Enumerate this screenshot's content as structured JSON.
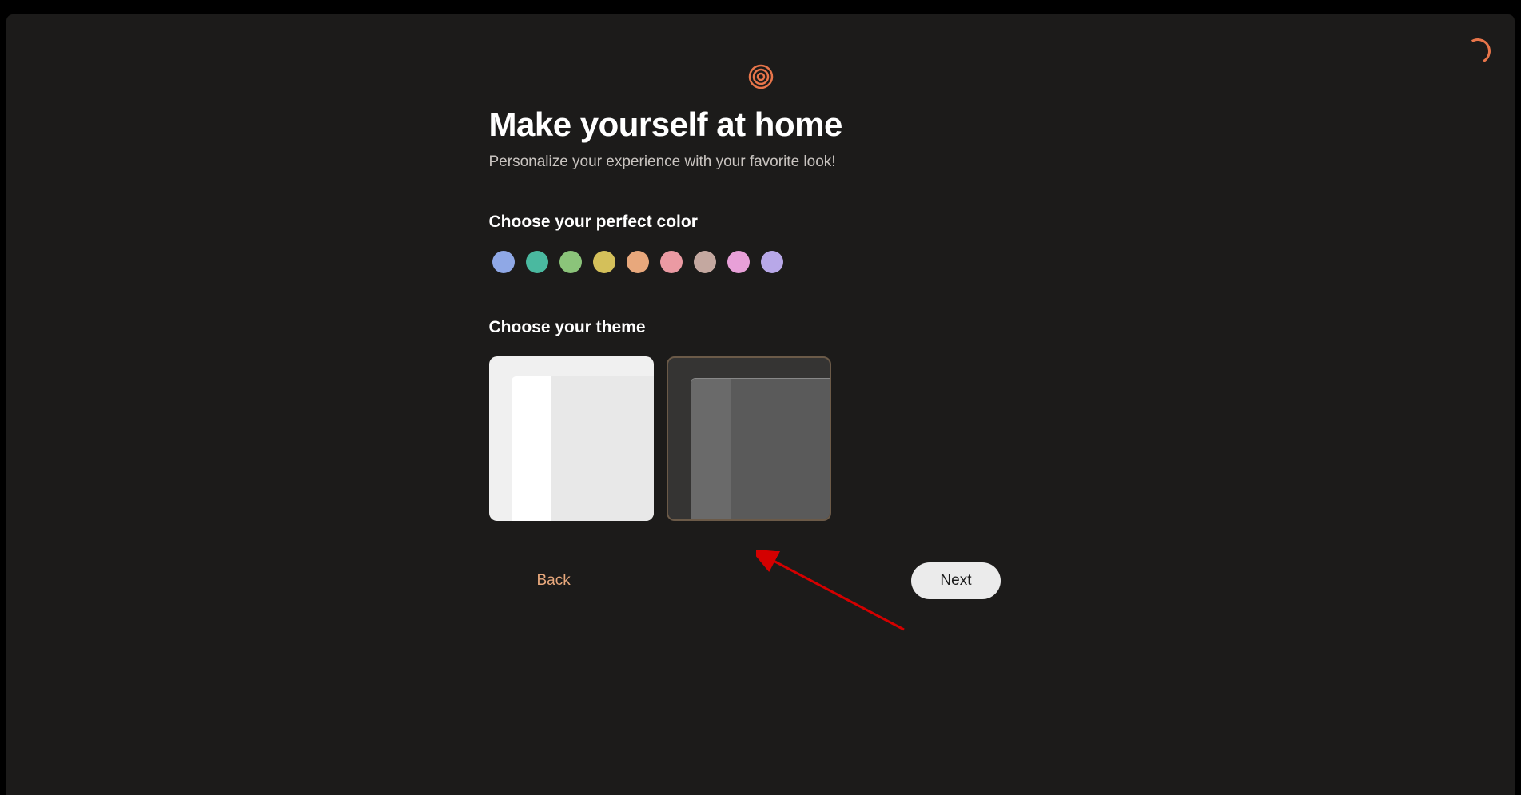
{
  "header": {
    "title": "Make yourself at home",
    "subtitle": "Personalize your experience with your favorite look!"
  },
  "sections": {
    "color": {
      "label": "Choose your perfect color",
      "options": [
        {
          "name": "blue",
          "hex": "#8fa8e6"
        },
        {
          "name": "teal",
          "hex": "#4ab9a0"
        },
        {
          "name": "green",
          "hex": "#8bc47a"
        },
        {
          "name": "yellow",
          "hex": "#d4c05a"
        },
        {
          "name": "orange",
          "hex": "#e8a87c"
        },
        {
          "name": "pink",
          "hex": "#eb9aa3"
        },
        {
          "name": "mauve",
          "hex": "#c4a8a0"
        },
        {
          "name": "magenta",
          "hex": "#e8a0d8"
        },
        {
          "name": "purple",
          "hex": "#b8a8e8"
        }
      ]
    },
    "theme": {
      "label": "Choose your theme",
      "options": [
        "light",
        "dark"
      ],
      "selected": "dark"
    }
  },
  "navigation": {
    "back_label": "Back",
    "next_label": "Next"
  },
  "colors": {
    "accent": "#e8754a",
    "accent_light": "#e8a87c"
  }
}
